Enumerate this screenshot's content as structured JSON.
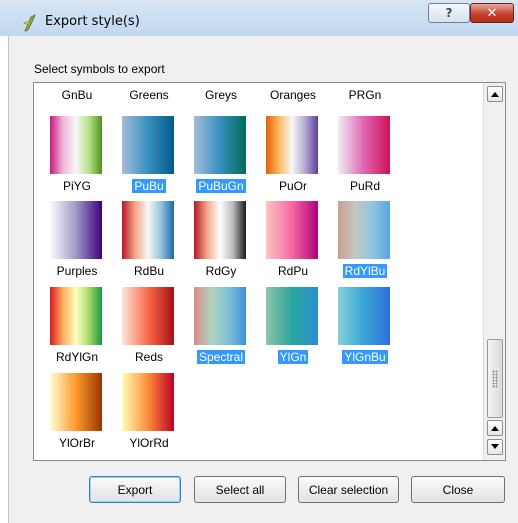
{
  "window": {
    "title": "Export style(s)",
    "help_glyph": "?",
    "close_glyph": "✕",
    "icon": "qgis-icon"
  },
  "prompt": "Select symbols to export",
  "symbols": [
    {
      "name": "GnBu",
      "selected": false,
      "partial": true,
      "colors": [
        "#f7fcf0",
        "#4eb3d3",
        "#084081"
      ]
    },
    {
      "name": "Greens",
      "selected": false,
      "partial": true,
      "colors": [
        "#f7fcf5",
        "#74c476",
        "#00441b"
      ]
    },
    {
      "name": "Greys",
      "selected": false,
      "partial": true,
      "colors": [
        "#ffffff",
        "#969696",
        "#000000"
      ]
    },
    {
      "name": "Oranges",
      "selected": false,
      "partial": true,
      "colors": [
        "#fff5eb",
        "#fd8d3c",
        "#7f2704"
      ]
    },
    {
      "name": "PRGn",
      "selected": false,
      "partial": true,
      "colors": [
        "#40004b",
        "#f7f7f7",
        "#00441b"
      ]
    },
    {
      "name": "PiYG",
      "selected": false,
      "partial": false,
      "colors": [
        "#c51b7d",
        "#f1b6da",
        "#f7f7f7",
        "#b8e186",
        "#4d9221"
      ]
    },
    {
      "name": "PuBu",
      "selected": true,
      "partial": false,
      "colors": [
        "#a6bddb",
        "#3690c0",
        "#045a8d"
      ]
    },
    {
      "name": "PuBuGn",
      "selected": true,
      "partial": false,
      "colors": [
        "#a6bddb",
        "#3690c0",
        "#016c59"
      ]
    },
    {
      "name": "PuOr",
      "selected": false,
      "partial": false,
      "colors": [
        "#e66101",
        "#fdb863",
        "#f7f7f7",
        "#b2abd2",
        "#5e3c99"
      ]
    },
    {
      "name": "PuRd",
      "selected": false,
      "partial": false,
      "colors": [
        "#f1eef6",
        "#df65b0",
        "#ce1256"
      ]
    },
    {
      "name": "Purples",
      "selected": false,
      "partial": false,
      "colors": [
        "#fcfbfd",
        "#9e9ac8",
        "#3f007d"
      ]
    },
    {
      "name": "RdBu",
      "selected": false,
      "partial": false,
      "colors": [
        "#b2182b",
        "#f4a582",
        "#f7f7f7",
        "#92c5de",
        "#2166ac"
      ]
    },
    {
      "name": "RdGy",
      "selected": false,
      "partial": false,
      "colors": [
        "#b2182b",
        "#f4a582",
        "#ffffff",
        "#bababa",
        "#1a1a1a"
      ]
    },
    {
      "name": "RdPu",
      "selected": false,
      "partial": false,
      "colors": [
        "#fcc5c0",
        "#f768a1",
        "#ae017e"
      ]
    },
    {
      "name": "RdYlBu",
      "selected": true,
      "partial": false,
      "colors": [
        "#c9a08e",
        "#c3c8c4",
        "#8ec4e6",
        "#5aa5dc"
      ]
    },
    {
      "name": "RdYlGn",
      "selected": false,
      "partial": false,
      "colors": [
        "#d7191c",
        "#fdae61",
        "#ffffbf",
        "#a6d96a",
        "#1a9641"
      ]
    },
    {
      "name": "Reds",
      "selected": false,
      "partial": false,
      "colors": [
        "#fee5d9",
        "#fb6a4a",
        "#a50f15"
      ]
    },
    {
      "name": "Spectral",
      "selected": true,
      "partial": false,
      "colors": [
        "#d98a86",
        "#b0d4c0",
        "#7fbfd7",
        "#3f8fd9"
      ]
    },
    {
      "name": "YlGn",
      "selected": true,
      "partial": false,
      "colors": [
        "#8fc4ae",
        "#2aa69b",
        "#2a8fd6"
      ]
    },
    {
      "name": "YlGnBu",
      "selected": true,
      "partial": false,
      "colors": [
        "#86d0d8",
        "#3aa5d6",
        "#2c6fdc"
      ]
    },
    {
      "name": "YlOrBr",
      "selected": false,
      "partial": false,
      "colors": [
        "#ffffd4",
        "#fe9929",
        "#993404"
      ]
    },
    {
      "name": "YlOrRd",
      "selected": false,
      "partial": false,
      "colors": [
        "#ffffb2",
        "#fd8d3c",
        "#bd0026"
      ]
    }
  ],
  "scrollbar": {
    "up_icon": "arrow-up-icon",
    "down_icon": "arrow-down-icon",
    "position": 0.95
  },
  "buttons": {
    "export": "Export",
    "select_all": "Select all",
    "clear_selection": "Clear selection",
    "close": "Close"
  },
  "colors": {
    "selection": "#3399ff",
    "dialog_bg": "#f0f0f0",
    "close_red": "#c7432f"
  }
}
